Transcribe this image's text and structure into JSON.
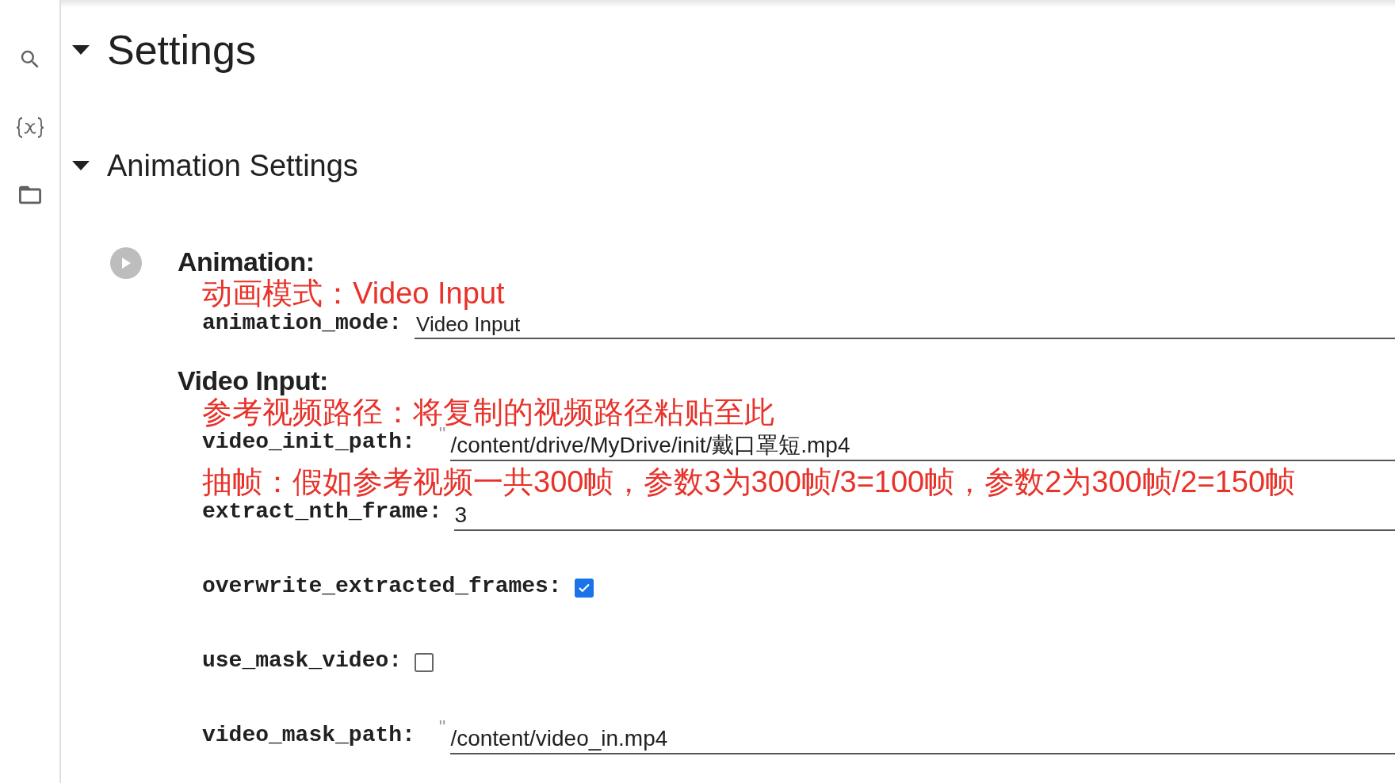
{
  "sections": [
    {
      "title": "Settings",
      "expanded": true
    },
    {
      "title": "Animation Settings",
      "expanded": true
    }
  ],
  "groups": [
    {
      "title": "Animation:",
      "fields": [
        {
          "kind": "dropdown",
          "label": "animation_mode:",
          "annotation": "动画模式：Video Input",
          "value": "Video Input"
        }
      ]
    },
    {
      "title": "Video Input:",
      "fields": [
        {
          "kind": "text",
          "label": "video_init_path:",
          "annotation": "参考视频路径：将复制的视频路径粘贴至此",
          "quote": "\"",
          "value": "/content/drive/MyDrive/init/戴口罩短.mp4"
        },
        {
          "kind": "number",
          "label": "extract_nth_frame:",
          "annotation": "抽帧：假如参考视频一共300帧，参数3为300帧/3=100帧，参数2为300帧/2=150帧",
          "value": "3"
        },
        {
          "kind": "checkbox",
          "label": "overwrite_extracted_frames:",
          "checked": true
        },
        {
          "kind": "checkbox",
          "label": "use_mask_video:",
          "checked": false
        },
        {
          "kind": "text",
          "label": "video_mask_path:",
          "quote": "\"",
          "value": "/content/video_in.mp4"
        }
      ]
    }
  ]
}
